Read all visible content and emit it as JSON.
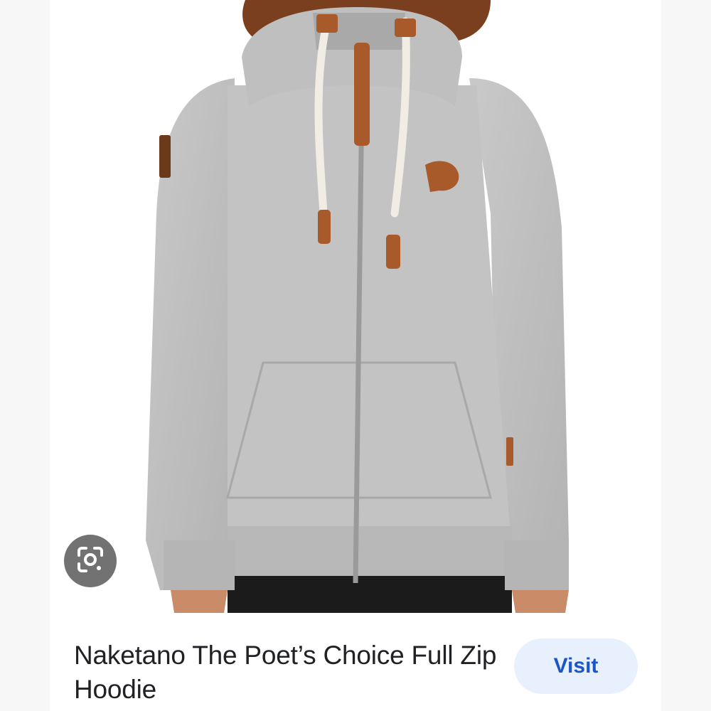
{
  "product": {
    "title": "Naketano The Poet’s Choice Full Zip Hoodie",
    "image_subject": "grey-full-zip-hoodie"
  },
  "actions": {
    "visit_label": "Visit",
    "lens_icon": "google-lens-icon"
  },
  "colors": {
    "hoodie": "#bdbdbd",
    "leather": "#a85a2a",
    "accent": "#1a56c8",
    "button_bg": "#e8f0fe"
  }
}
